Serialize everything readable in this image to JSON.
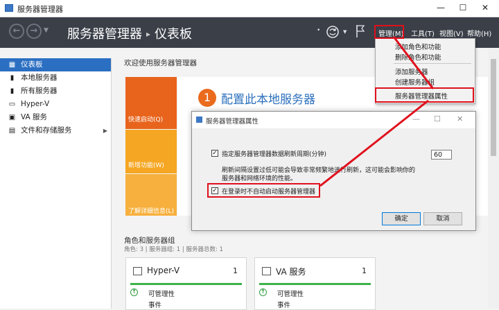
{
  "window": {
    "title": "服务器管理器",
    "controls": {
      "minimize": "—",
      "maximize": "☐",
      "close": "✕"
    }
  },
  "navbar": {
    "breadcrumb_root": "服务器管理器",
    "breadcrumb_sep": "▸",
    "breadcrumb_page": "仪表板",
    "back_icon": "back-arrow-icon",
    "forward_icon": "forward-arrow-icon",
    "menus": [
      {
        "label": "管理(M)"
      },
      {
        "label": "工具(T)"
      },
      {
        "label": "视图(V)"
      },
      {
        "label": "帮助(H)"
      }
    ]
  },
  "manage_menu": {
    "items": [
      {
        "label": "添加角色和功能"
      },
      {
        "label": "删除角色和功能"
      },
      {
        "label": "添加服务器"
      },
      {
        "label": "创建服务器组"
      },
      {
        "label": "服务器管理器属性"
      }
    ]
  },
  "sidebar": {
    "items": [
      {
        "label": "仪表板",
        "icon": "dashboard-icon"
      },
      {
        "label": "本地服务器",
        "icon": "local-server-icon"
      },
      {
        "label": "所有服务器",
        "icon": "all-servers-icon"
      },
      {
        "label": "Hyper-V",
        "icon": "hyper-v-icon"
      },
      {
        "label": "VA 服务",
        "icon": "va-service-icon"
      },
      {
        "label": "文件和存储服务",
        "icon": "file-storage-icon"
      }
    ]
  },
  "main": {
    "welcome": "欢迎使用服务器管理器",
    "tiles": [
      {
        "label": "快速启动(Q)",
        "color": "#e8641c"
      },
      {
        "label": "新增功能(W)",
        "color": "#f5a623"
      },
      {
        "label": "了解详细信息(L)",
        "color": "#f7b03e"
      }
    ],
    "config_number": "1",
    "config_text": "配置此本地服务器",
    "roles_title": "角色和服务器组",
    "roles_summary": "角色: 3 | 服务器组: 1 | 服务器总数: 1",
    "cards": [
      {
        "name": "Hyper-V",
        "count": "1",
        "status": "可管理性",
        "line2": "事件"
      },
      {
        "name": "VA 服务",
        "count": "1",
        "status": "可管理性",
        "line2": "事件"
      }
    ]
  },
  "dialog": {
    "title": "服务器管理器属性",
    "refresh_label": "指定服务器管理器数据刷新周期(分钟)",
    "refresh_value": "60",
    "note_line1": "刷新间隔设置过低可能会导致非常频繁地进行刷新，这可能会影响你的",
    "note_line2": "服务器和网络环境的性能。",
    "autostart_label": "在登录时不自动启动服务器管理器",
    "ok_label": "确定",
    "cancel_label": "取消",
    "controls": {
      "minimize": "—",
      "maximize": "☐",
      "close": "✕"
    }
  },
  "colors": {
    "navbar": "#3a3f48",
    "sidebar_active": "#2b6fc2",
    "highlight": "#e0101c",
    "accent_orange": "#e8641c",
    "status_green": "#3cb34a"
  }
}
